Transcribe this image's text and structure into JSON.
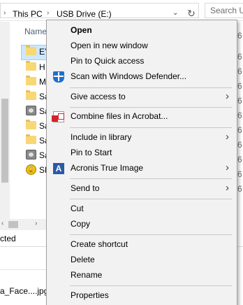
{
  "explorer": {
    "breadcrumb": [
      "This PC",
      "USB Drive (E:)"
    ],
    "search_placeholder": "Search U",
    "column_name": "Name",
    "files": [
      {
        "label": "EY",
        "icon": "folder-icon"
      },
      {
        "label": "H",
        "icon": "folder-icon"
      },
      {
        "label": "M",
        "icon": "folder-icon"
      },
      {
        "label": "Sa",
        "icon": "folder-icon"
      },
      {
        "label": "Sa",
        "icon": "image-file-icon"
      },
      {
        "label": "Sa",
        "icon": "folder-icon"
      },
      {
        "label": "Sa",
        "icon": "folder-icon"
      },
      {
        "label": "Sa",
        "icon": "image-file-icon"
      },
      {
        "label": "SE",
        "icon": "locked-file-icon"
      }
    ],
    "right_column_values": [
      "6",
      "6",
      "6",
      "6",
      "6",
      "6",
      "6",
      "6",
      "6",
      "6",
      "6"
    ],
    "status_text": "cted",
    "bottom_file": "a_Face....jpg"
  },
  "context_menu": {
    "items": [
      {
        "label": "Open",
        "bold": true
      },
      {
        "label": "Open in new window"
      },
      {
        "label": "Pin to Quick access"
      },
      {
        "label": "Scan with Windows Defender...",
        "icon": "windows-defender-icon"
      },
      {
        "label": "Give access to",
        "submenu": true
      },
      {
        "label": "Combine files in Acrobat...",
        "icon": "acrobat-icon"
      },
      {
        "label": "Include in library",
        "submenu": true
      },
      {
        "label": "Pin to Start"
      },
      {
        "label": "Acronis True Image",
        "icon": "acronis-icon",
        "submenu": true
      },
      {
        "label": "Send to",
        "submenu": true
      },
      {
        "label": "Cut"
      },
      {
        "label": "Copy"
      },
      {
        "label": "Create shortcut"
      },
      {
        "label": "Delete"
      },
      {
        "label": "Rename"
      },
      {
        "label": "Properties"
      }
    ],
    "acronis_glyph": "A",
    "submenu_arrow": "›"
  },
  "colors": {
    "menu_background": "#f2f2f2",
    "selection": "#cce8ff",
    "defender_blue": "#1f6fd1",
    "acrobat_red": "#d2232a"
  }
}
